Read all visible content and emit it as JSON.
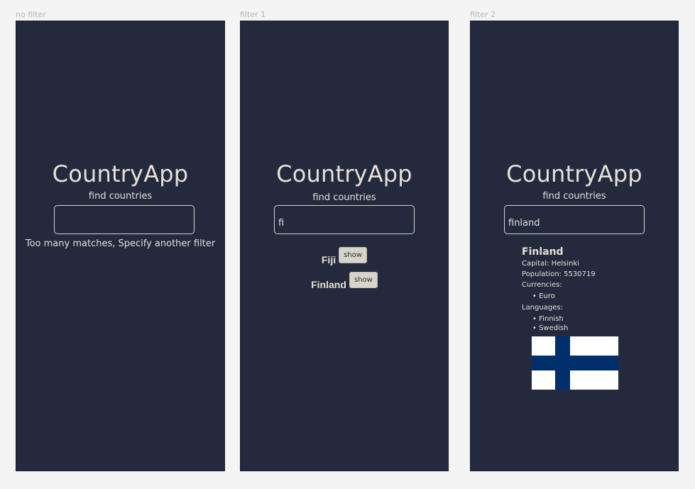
{
  "frames": [
    {
      "label": "no filter"
    },
    {
      "label": "filter 1"
    },
    {
      "label": "filter 2"
    }
  ],
  "app": {
    "title": "CountryApp",
    "subtitle": "find countries"
  },
  "no_filter": {
    "search_value": "",
    "message": "Too many matches, Specify another filter"
  },
  "filter1": {
    "search_value": "fi",
    "results": [
      {
        "name": "Fiji",
        "button": "show"
      },
      {
        "name": "Finland",
        "button": "show"
      }
    ]
  },
  "filter2": {
    "search_value": "finland",
    "country": {
      "name": "Finland",
      "capital": "Capital: Helsinki",
      "population": "Population: 5530719",
      "currencies_label": "Currencies:",
      "currencies": [
        "Euro"
      ],
      "languages_label": "Languages:",
      "languages": [
        "Finnish",
        "Swedish"
      ],
      "flag_colors": {
        "field": "#ffffff",
        "cross": "#002f6c"
      }
    }
  }
}
